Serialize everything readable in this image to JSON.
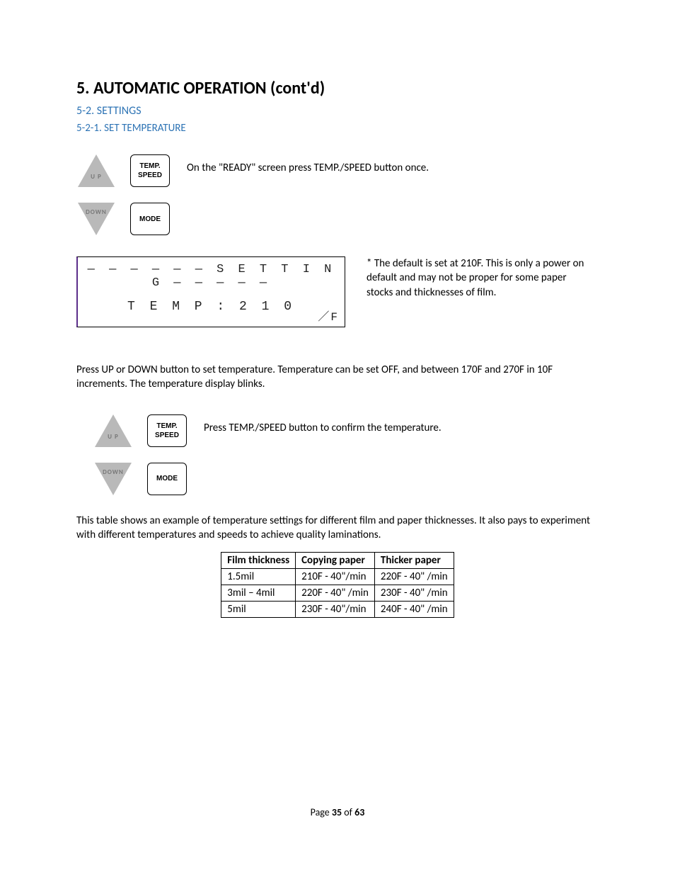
{
  "heading": "5. AUTOMATIC OPERATION (cont'd)",
  "sub1": "5-2. SETTINGS",
  "sub2": "5-2-1. SET TEMPERATURE",
  "buttons": {
    "up": "U P",
    "down": "DOWN",
    "tempspeed_line1": "TEMP.",
    "tempspeed_line2": "SPEED",
    "mode": "MODE"
  },
  "instruction1": "On the \"READY\" screen press TEMP./SPEED button once.",
  "lcd": {
    "line1": "— — — — — —  S E T T I N G  — — — — —",
    "line2": "T E M P : 2 1 0",
    "unit": "／F"
  },
  "lcd_note": "* The default is set at 210F. This is only a power on default and may not be proper for some paper stocks and thicknesses of film.",
  "paragraph1": "Press UP or DOWN button to set temperature. Temperature can be set OFF, and between 170F and 270F in 10F increments. The temperature display blinks.",
  "instruction2": "Press TEMP./SPEED button to  confirm the temperature.",
  "paragraph2": "This table shows an example of temperature settings for different film and paper thicknesses. It also pays to experiment with different temperatures and speeds to achieve quality laminations.",
  "table": {
    "headers": [
      "Film thickness",
      "Copying paper",
      "Thicker paper"
    ],
    "rows": [
      [
        "1.5mil",
        "210F -  40\"/min",
        "220F - 40\" /min"
      ],
      [
        "3mil – 4mil",
        "220F - 40\" /min",
        "230F - 40\" /min"
      ],
      [
        "5mil",
        "230F - 40\"/min",
        "240F - 40\" /min"
      ]
    ]
  },
  "footer": {
    "prefix": "Page ",
    "current": "35",
    "middle": " of ",
    "total": "63"
  }
}
